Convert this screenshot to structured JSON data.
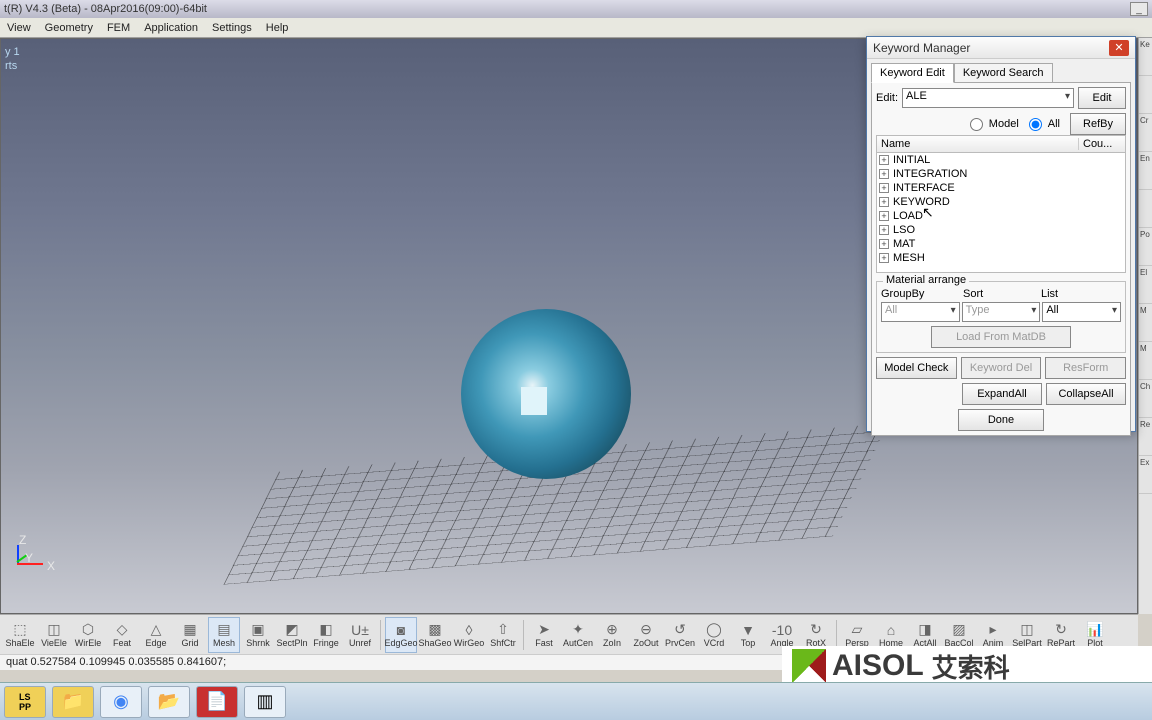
{
  "titlebar": {
    "title": "t(R) V4.3 (Beta) - 08Apr2016(09:00)-64bit"
  },
  "menu": [
    "View",
    "Geometry",
    "FEM",
    "Application",
    "Settings",
    "Help"
  ],
  "viewport": {
    "hint1": "y 1",
    "hint2": "rts"
  },
  "axis": {
    "x": "X",
    "y": "Y",
    "z": "Z"
  },
  "dialog": {
    "title": "Keyword Manager",
    "tabs": {
      "edit": "Keyword Edit",
      "search": "Keyword Search"
    },
    "editLabel": "Edit:",
    "editValue": "ALE",
    "editBtn": "Edit",
    "modelRadio": "Model",
    "allRadio": "All",
    "refBtn": "RefBy",
    "colName": "Name",
    "colCount": "Cou...",
    "tree": [
      "INITIAL",
      "INTEGRATION",
      "INTERFACE",
      "KEYWORD",
      "LOAD",
      "LSO",
      "MAT",
      "MESH"
    ],
    "groupTitle": "Material arrange",
    "groupByLbl": "GroupBy",
    "sortLbl": "Sort",
    "listLbl": "List",
    "groupByVal": "All",
    "sortVal": "Type",
    "listVal": "All",
    "loadMat": "Load From MatDB",
    "modelCheck": "Model Check",
    "kwdDel": "Keyword Del",
    "resForm": "ResForm",
    "expandAll": "ExpandAll",
    "collapseAll": "CollapseAll",
    "done": "Done"
  },
  "toolbar": [
    {
      "l": "ShaEle",
      "g": "⬚"
    },
    {
      "l": "VieEle",
      "g": "◫"
    },
    {
      "l": "WirEle",
      "g": "⬡"
    },
    {
      "l": "Feat",
      "g": "◇"
    },
    {
      "l": "Edge",
      "g": "△"
    },
    {
      "l": "Grid",
      "g": "▦"
    },
    {
      "l": "Mesh",
      "g": "▤",
      "a": true
    },
    {
      "l": "Shrnk",
      "g": "▣"
    },
    {
      "l": "SectPln",
      "g": "◩"
    },
    {
      "l": "Fringe",
      "g": "◧"
    },
    {
      "l": "Unref",
      "g": "U±"
    },
    {
      "sep": true
    },
    {
      "l": "EdgGeo",
      "g": "◙",
      "a": true
    },
    {
      "l": "ShaGeo",
      "g": "▩"
    },
    {
      "l": "WirGeo",
      "g": "◊"
    },
    {
      "l": "ShfCtr",
      "g": "⇧"
    },
    {
      "sep": true
    },
    {
      "l": "Fast",
      "g": "➤"
    },
    {
      "l": "AutCen",
      "g": "✦"
    },
    {
      "l": "ZoIn",
      "g": "⊕"
    },
    {
      "l": "ZoOut",
      "g": "⊖"
    },
    {
      "l": "PrvCen",
      "g": "↺"
    },
    {
      "l": "VCrd",
      "g": "◯"
    },
    {
      "l": "Top",
      "g": "▼"
    },
    {
      "l": "Angle",
      "g": "-10"
    },
    {
      "l": "RotX",
      "g": "↻"
    },
    {
      "sep": true
    },
    {
      "l": "Persp",
      "g": "▱"
    },
    {
      "l": "Home",
      "g": "⌂"
    },
    {
      "l": "ActAll",
      "g": "◨"
    },
    {
      "l": "BacCol",
      "g": "▨"
    },
    {
      "l": "Anim",
      "g": "▸"
    },
    {
      "l": "SelPart",
      "g": "◫"
    },
    {
      "l": "RePart",
      "g": "↻"
    },
    {
      "l": "Plot",
      "g": "📊"
    }
  ],
  "status": "quat 0.527584 0.109945 0.035585 0.841607;",
  "logo": {
    "text": "AISOL",
    "cn": "艾索科"
  },
  "rightLabels": [
    "Ke",
    "",
    "Cr",
    "En",
    "",
    "Po",
    "El",
    "M",
    "M",
    "Ch",
    "Re",
    "Ex"
  ]
}
